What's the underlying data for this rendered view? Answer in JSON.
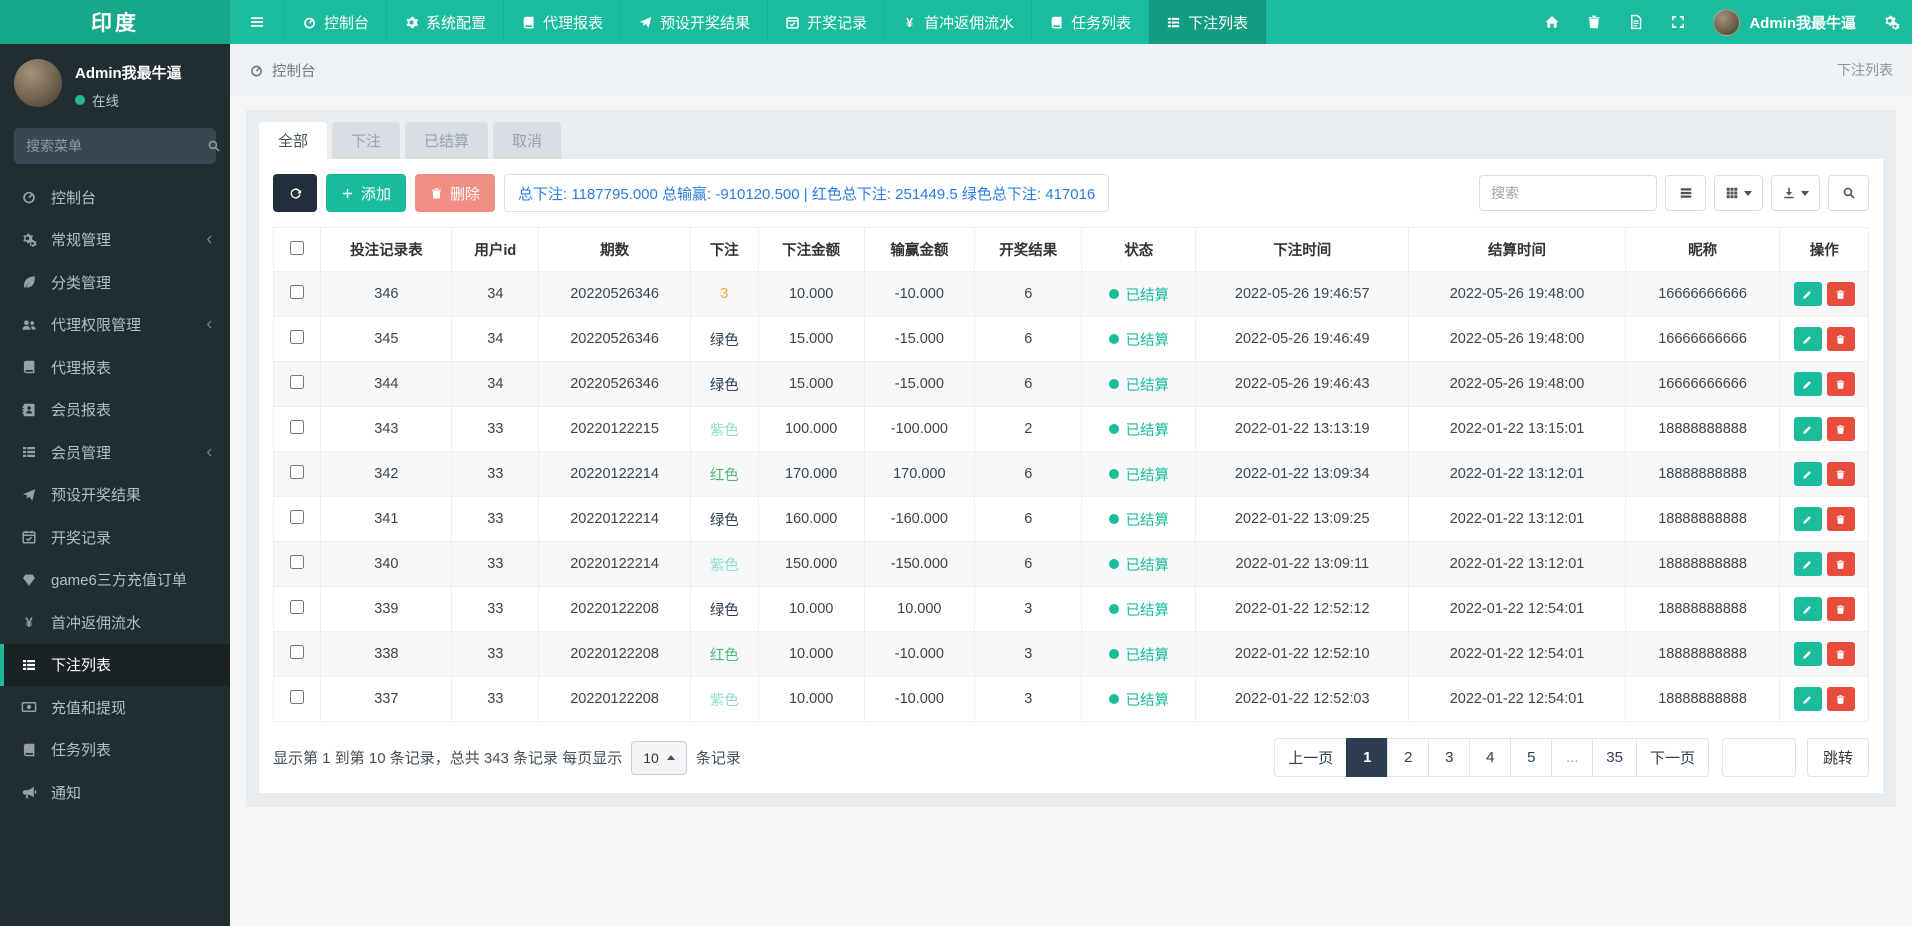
{
  "brand": {
    "logo": "印度"
  },
  "topnav": {
    "items": [
      {
        "label": "控制台",
        "icon": "gauge",
        "active": false
      },
      {
        "label": "系统配置",
        "icon": "gear",
        "active": false
      },
      {
        "label": "代理报表",
        "icon": "book",
        "active": false
      },
      {
        "label": "预设开奖结果",
        "icon": "send",
        "active": false
      },
      {
        "label": "开奖记录",
        "icon": "calendar-check",
        "active": false
      },
      {
        "label": "首冲返佣流水",
        "icon": "yen",
        "active": false
      },
      {
        "label": "任务列表",
        "icon": "book",
        "active": false
      },
      {
        "label": "下注列表",
        "icon": "th-list",
        "active": true
      }
    ],
    "right_icons": [
      {
        "name": "home"
      },
      {
        "name": "trash"
      },
      {
        "name": "file"
      },
      {
        "name": "expand"
      }
    ],
    "user_name": "Admin我最牛逼"
  },
  "sidebar": {
    "user_name": "Admin我最牛逼",
    "user_status": "在线",
    "search_placeholder": "搜索菜单",
    "menu": [
      {
        "label": "控制台",
        "icon": "gauge",
        "chevron": false,
        "active": false
      },
      {
        "label": "常规管理",
        "icon": "cogs",
        "chevron": true,
        "active": false
      },
      {
        "label": "分类管理",
        "icon": "leaf",
        "chevron": false,
        "active": false
      },
      {
        "label": "代理权限管理",
        "icon": "users",
        "chevron": true,
        "active": false
      },
      {
        "label": "代理报表",
        "icon": "book",
        "chevron": false,
        "active": false
      },
      {
        "label": "会员报表",
        "icon": "address-book",
        "chevron": false,
        "active": false
      },
      {
        "label": "会员管理",
        "icon": "th-list",
        "chevron": true,
        "active": false
      },
      {
        "label": "预设开奖结果",
        "icon": "send",
        "chevron": false,
        "active": false
      },
      {
        "label": "开奖记录",
        "icon": "calendar-check",
        "chevron": false,
        "active": false
      },
      {
        "label": "game6三方充值订单",
        "icon": "gem",
        "chevron": false,
        "active": false
      },
      {
        "label": "首冲返佣流水",
        "icon": "yen",
        "chevron": false,
        "active": false
      },
      {
        "label": "下注列表",
        "icon": "th-list",
        "chevron": false,
        "active": true
      },
      {
        "label": "充值和提现",
        "icon": "money",
        "chevron": false,
        "active": false
      },
      {
        "label": "任务列表",
        "icon": "book",
        "chevron": false,
        "active": false
      },
      {
        "label": "通知",
        "icon": "bullhorn",
        "chevron": false,
        "active": false
      }
    ]
  },
  "breadcrumb": {
    "section": "控制台",
    "page": "下注列表"
  },
  "tabs": [
    {
      "label": "全部",
      "active": true
    },
    {
      "label": "下注",
      "active": false
    },
    {
      "label": "已结算",
      "active": false
    },
    {
      "label": "取消",
      "active": false
    }
  ],
  "toolbar": {
    "add_label": "添加",
    "delete_label": "删除",
    "summary": "总下注: 1187795.000 总输赢: -910120.500 | 红色总下注: 251449.5 绿色总下注: 417016",
    "search_placeholder": "搜索"
  },
  "table": {
    "columns": [
      "投注记录表",
      "用户id",
      "期数",
      "下注",
      "下注金额",
      "输赢金额",
      "开奖结果",
      "状态",
      "下注时间",
      "结算时间",
      "昵称",
      "操作"
    ],
    "rows": [
      {
        "id": "346",
        "uid": "34",
        "period": "20220526346",
        "bet": "3",
        "bet_color": "#f5a43c",
        "amount": "10.000",
        "winlose": "-10.000",
        "result": "6",
        "status": "已结算",
        "bet_time": "2022-05-26 19:46:57",
        "settle_time": "2022-05-26 19:48:00",
        "nick": "16666666666"
      },
      {
        "id": "345",
        "uid": "34",
        "period": "20220526346",
        "bet": "绿色",
        "bet_color": "#2c3e50",
        "amount": "15.000",
        "winlose": "-15.000",
        "result": "6",
        "status": "已结算",
        "bet_time": "2022-05-26 19:46:49",
        "settle_time": "2022-05-26 19:48:00",
        "nick": "16666666666"
      },
      {
        "id": "344",
        "uid": "34",
        "period": "20220526346",
        "bet": "绿色",
        "bet_color": "#2c3e50",
        "amount": "15.000",
        "winlose": "-15.000",
        "result": "6",
        "status": "已结算",
        "bet_time": "2022-05-26 19:46:43",
        "settle_time": "2022-05-26 19:48:00",
        "nick": "16666666666"
      },
      {
        "id": "343",
        "uid": "33",
        "period": "20220122215",
        "bet": "紫色",
        "bet_color": "#8ddfce",
        "amount": "100.000",
        "winlose": "-100.000",
        "result": "2",
        "status": "已结算",
        "bet_time": "2022-01-22 13:13:19",
        "settle_time": "2022-01-22 13:15:01",
        "nick": "18888888888"
      },
      {
        "id": "342",
        "uid": "33",
        "period": "20220122214",
        "bet": "红色",
        "bet_color": "#4eb87b",
        "amount": "170.000",
        "winlose": "170.000",
        "result": "6",
        "status": "已结算",
        "bet_time": "2022-01-22 13:09:34",
        "settle_time": "2022-01-22 13:12:01",
        "nick": "18888888888"
      },
      {
        "id": "341",
        "uid": "33",
        "period": "20220122214",
        "bet": "绿色",
        "bet_color": "#2c3e50",
        "amount": "160.000",
        "winlose": "-160.000",
        "result": "6",
        "status": "已结算",
        "bet_time": "2022-01-22 13:09:25",
        "settle_time": "2022-01-22 13:12:01",
        "nick": "18888888888"
      },
      {
        "id": "340",
        "uid": "33",
        "period": "20220122214",
        "bet": "紫色",
        "bet_color": "#8ddfce",
        "amount": "150.000",
        "winlose": "-150.000",
        "result": "6",
        "status": "已结算",
        "bet_time": "2022-01-22 13:09:11",
        "settle_time": "2022-01-22 13:12:01",
        "nick": "18888888888"
      },
      {
        "id": "339",
        "uid": "33",
        "period": "20220122208",
        "bet": "绿色",
        "bet_color": "#2c3e50",
        "amount": "10.000",
        "winlose": "10.000",
        "result": "3",
        "status": "已结算",
        "bet_time": "2022-01-22 12:52:12",
        "settle_time": "2022-01-22 12:54:01",
        "nick": "18888888888"
      },
      {
        "id": "338",
        "uid": "33",
        "period": "20220122208",
        "bet": "红色",
        "bet_color": "#4eb87b",
        "amount": "10.000",
        "winlose": "-10.000",
        "result": "3",
        "status": "已结算",
        "bet_time": "2022-01-22 12:52:10",
        "settle_time": "2022-01-22 12:54:01",
        "nick": "18888888888"
      },
      {
        "id": "337",
        "uid": "33",
        "period": "20220122208",
        "bet": "紫色",
        "bet_color": "#8ddfce",
        "amount": "10.000",
        "winlose": "-10.000",
        "result": "3",
        "status": "已结算",
        "bet_time": "2022-01-22 12:52:03",
        "settle_time": "2022-01-22 12:54:01",
        "nick": "18888888888"
      }
    ]
  },
  "footer": {
    "info_prefix": "显示第 1 到第 10 条记录，总共 343 条记录 每页显示",
    "page_size": "10",
    "info_suffix": "条记录",
    "pages": [
      "上一页",
      "1",
      "2",
      "3",
      "4",
      "5",
      "...",
      "35",
      "下一页"
    ],
    "active_page": "1",
    "jump_label": "跳转"
  },
  "colors": {
    "navbar_teal": "#1bbc9d",
    "logo_teal": "#17a88c",
    "active_nav_teal": "#149c82",
    "sidebar_dark": "#222d32",
    "accent_teal": "#1abc9c",
    "primary_dark": "#2c3e50",
    "danger_red": "#e74c3c",
    "delete_salmon": "#f08e83",
    "summary_blue": "#2a7de0",
    "bet_orange": "#f5a43c",
    "bet_green_text": "#4eb87b",
    "bet_purple_text": "#8ddfce"
  }
}
